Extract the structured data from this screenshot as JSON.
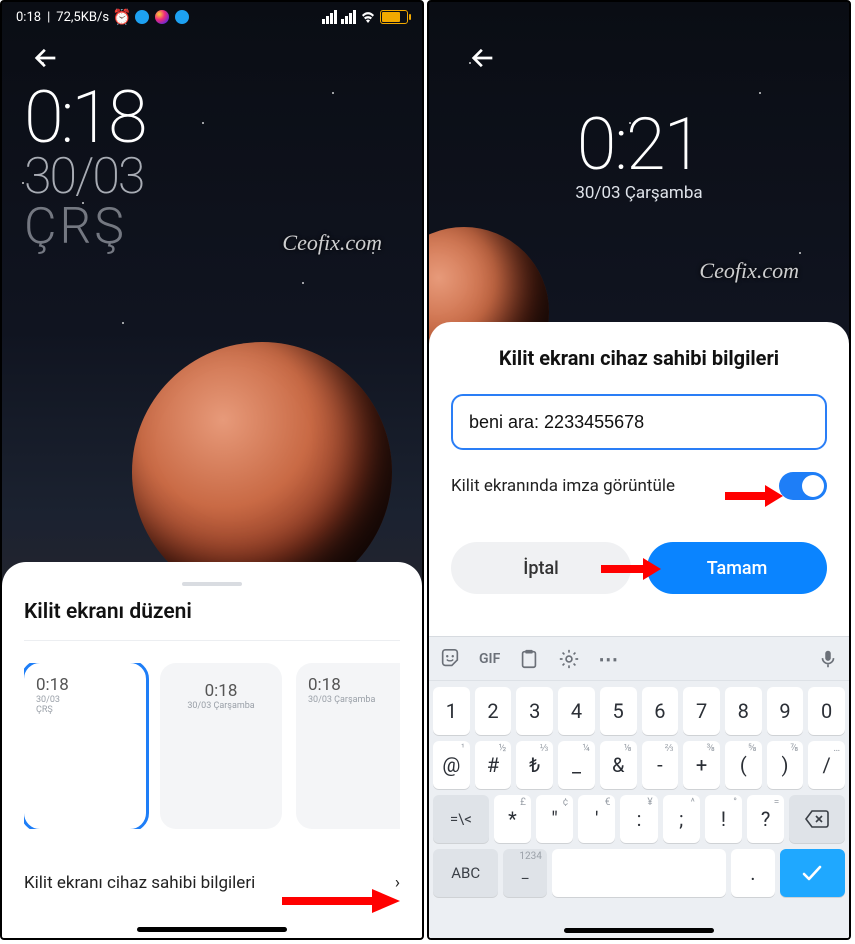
{
  "left": {
    "status": {
      "time": "0:18",
      "speed": "72,5KB/s"
    },
    "clock": {
      "time": "0:18",
      "date": "30/03",
      "weekday": "ÇRŞ"
    },
    "watermark": "Ceofix.com",
    "sheet": {
      "title": "Kilit ekranı düzeni",
      "cards": [
        {
          "time": "0:18",
          "sub1": "30/03",
          "sub2": "ÇRŞ"
        },
        {
          "time": "0:18",
          "sub": "30/03 Çarşamba"
        },
        {
          "time": "0:18",
          "sub": "30/03 Çarşamba"
        }
      ],
      "owner_info": "Kilit ekranı cihaz sahibi bilgileri"
    }
  },
  "right": {
    "clock": {
      "time": "0:21",
      "date_full": "30/03 Çarşamba"
    },
    "watermark": "Ceofix.com",
    "sheet": {
      "title": "Kilit ekranı cihaz sahibi bilgileri",
      "input_value": "beni ara: 2233455678",
      "switch_label": "Kilit ekranında imza görüntüle",
      "cancel": "İptal",
      "ok": "Tamam"
    },
    "keyboard": {
      "top": {
        "gif": "GIF"
      },
      "row1": [
        "1",
        "2",
        "3",
        "4",
        "5",
        "6",
        "7",
        "8",
        "9",
        "0"
      ],
      "row2": [
        {
          "m": "@",
          "s": "¹"
        },
        {
          "m": "#",
          "s": "½"
        },
        {
          "m": "₺",
          "s": "⅓"
        },
        {
          "m": "_",
          "s": "¼"
        },
        {
          "m": "&",
          "s": "⅛"
        },
        {
          "m": "-",
          "s": "⅔"
        },
        {
          "m": "+",
          "s": "⅜"
        },
        {
          "m": "(",
          "s": "⅝"
        },
        {
          "m": ")",
          "s": "⅞"
        },
        {
          "m": "/",
          "s": "…"
        }
      ],
      "row3": {
        "shift": "=\\<",
        "keys": [
          {
            "m": "*",
            "s": "£"
          },
          {
            "m": "\"",
            "s": "¢"
          },
          {
            "m": "'",
            "s": "€"
          },
          {
            "m": ":",
            "s": "¥"
          },
          {
            "m": ";",
            "s": "^"
          },
          {
            "m": "!",
            "s": "°"
          },
          {
            "m": "?",
            "s": "="
          }
        ]
      },
      "row4": {
        "abc": "ABC",
        "middle": {
          "m": "_",
          "s": "1234"
        },
        "period": "."
      }
    }
  }
}
